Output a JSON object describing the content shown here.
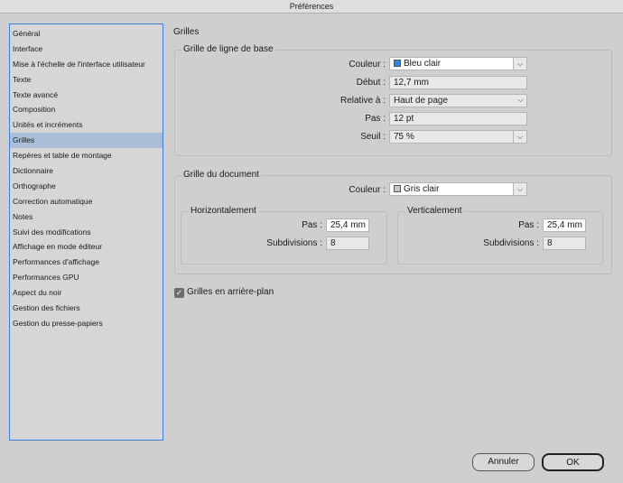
{
  "window": {
    "title": "Préférences"
  },
  "sidebar": {
    "items": [
      "Général",
      "Interface",
      "Mise à l'échelle de l'interface utilisateur",
      "Texte",
      "Texte avancé",
      "Composition",
      "Unités et incréments",
      "Grilles",
      "Repères et table de montage",
      "Dictionnaire",
      "Orthographe",
      "Correction automatique",
      "Notes",
      "Suivi des modifications",
      "Affichage en mode éditeur",
      "Performances d'affichage",
      "Performances GPU",
      "Aspect du noir",
      "Gestion des fichiers",
      "Gestion du presse-papiers"
    ],
    "selected_index": 7
  },
  "main": {
    "section_title": "Grilles",
    "baseline": {
      "title": "Grille de ligne de base",
      "color_label": "Couleur :",
      "color_value": "Bleu clair",
      "color_swatch": "#2f86e8",
      "start_label": "Début :",
      "start_value": "12,7 mm",
      "relative_label": "Relative à :",
      "relative_value": "Haut de page",
      "step_label": "Pas :",
      "step_value": "12 pt",
      "threshold_label": "Seuil :",
      "threshold_value": "75 %"
    },
    "document": {
      "title": "Grille du document",
      "color_label": "Couleur :",
      "color_value": "Gris clair",
      "color_swatch": "#c8c8c8",
      "horizontal": {
        "title": "Horizontalement",
        "step_label": "Pas :",
        "step_value": "25,4 mm",
        "subdiv_label": "Subdivisions :",
        "subdiv_value": "8"
      },
      "vertical": {
        "title": "Verticalement",
        "step_label": "Pas :",
        "step_value": "25,4 mm",
        "subdiv_label": "Subdivisions :",
        "subdiv_value": "8"
      }
    },
    "background_grids": {
      "label": "Grilles en arrière-plan",
      "checked": true
    }
  },
  "footer": {
    "cancel_label": "Annuler",
    "ok_label": "OK"
  },
  "icons": {
    "dropdown": "chevron-down-icon",
    "check": "checkmark-icon"
  }
}
